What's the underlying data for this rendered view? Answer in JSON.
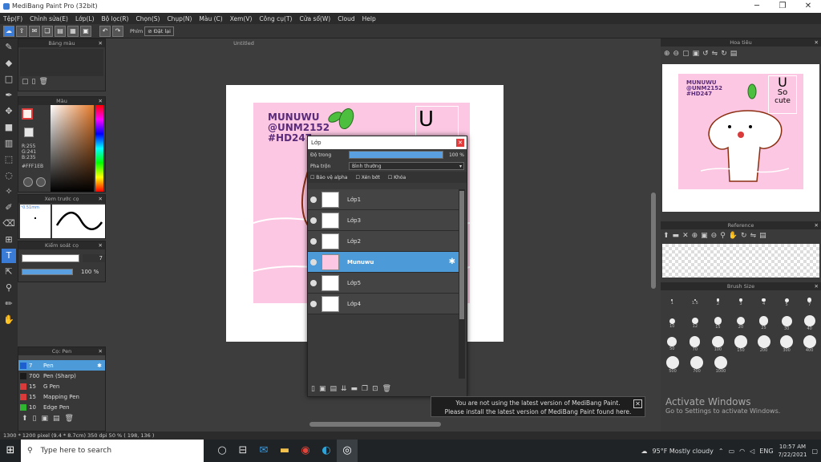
{
  "window": {
    "title": "MediBang Paint Pro (32bit)"
  },
  "menu": [
    "Tệp(F)",
    "Chỉnh sửa(E)",
    "Lớp(L)",
    "Bộ lọc(R)",
    "Chọn(S)",
    "Chụp(N)",
    "Màu (C)",
    "Xem(V)",
    "Công cụ(T)",
    "Cửa sổ(W)",
    "Cloud",
    "Help"
  ],
  "toolbar": {
    "filter_label": "Phím",
    "reset_label": "Đặt lại"
  },
  "panels": {
    "palette": "Bảng màu",
    "color": "Màu",
    "preview": "Xem trước cọ",
    "control": "Kiểm soát cọ",
    "brush": "Cọ: Pen",
    "navigator": "Hoa tiêu",
    "reference": "Reference",
    "brush_size": "Brush Size"
  },
  "color": {
    "r": "R:255",
    "g": "G:241",
    "b": "B:235",
    "hex": "#FFF1EB",
    "main": "#FFF1EB"
  },
  "preview": {
    "size": "0.51mm"
  },
  "control": {
    "size_value": "7",
    "opacity": "100 %"
  },
  "brushes": [
    {
      "size": "7",
      "name": "Pen",
      "color": "#1e5fd0",
      "selected": true
    },
    {
      "size": "700",
      "name": "Pen (Sharp)",
      "color": "#1a1a1a",
      "selected": false
    },
    {
      "size": "15",
      "name": "G Pen",
      "color": "#d93a3a",
      "selected": false
    },
    {
      "size": "15",
      "name": "Mapping Pen",
      "color": "#d93a3a",
      "selected": false
    },
    {
      "size": "10",
      "name": "Edge Pen",
      "color": "#2fb52f",
      "selected": false
    }
  ],
  "document": {
    "name": "Untitled"
  },
  "artwork": {
    "line1": "MUNUWU",
    "line2": "@UNM2152",
    "line3": "#HD247",
    "u": "U",
    "so": "So",
    "cute": "cute"
  },
  "layer_window": {
    "title": "Lớp",
    "opacity_label": "Độ trong",
    "opacity_value": "100 %",
    "opacity_fraction": 1.0,
    "blend_label": "Pha trộn",
    "blend_value": "Bình thường",
    "protect_alpha": "Bảo vệ alpha",
    "clip": "Xén bớt",
    "lock": "Khóa",
    "layers": [
      {
        "name": "Lớp1",
        "selected": false
      },
      {
        "name": "Lớp3",
        "selected": false
      },
      {
        "name": "Lớp2",
        "selected": false
      },
      {
        "name": "Munuwu",
        "selected": true
      },
      {
        "name": "Lớp5",
        "selected": false
      },
      {
        "name": "Lớp4",
        "selected": false
      }
    ]
  },
  "brush_sizes": [
    [
      "1",
      "1.5",
      "2",
      "3",
      "4",
      "5",
      "7"
    ],
    [
      "10",
      "12",
      "15",
      "20",
      "25",
      "30",
      "40"
    ],
    [
      "50",
      "70",
      "100",
      "150",
      "200",
      "300",
      "400"
    ],
    [
      "500",
      "700",
      "1000"
    ]
  ],
  "notification": {
    "line1": "You are not using the latest version of MediBang Paint.",
    "line2": "Please install the latest version of MediBang Paint found here."
  },
  "watermark": {
    "line1": "Activate Windows",
    "line2": "Go to Settings to activate Windows."
  },
  "status": "1300 * 1200 pixel  (9.4 * 8.7cm)  350 dpi  50 %  ( 198, 136 )",
  "taskbar": {
    "search": "Type here to search",
    "weather": "95°F  Mostly cloudy",
    "lang": "ENG",
    "time": "10:57 AM",
    "date": "7/22/2021"
  }
}
